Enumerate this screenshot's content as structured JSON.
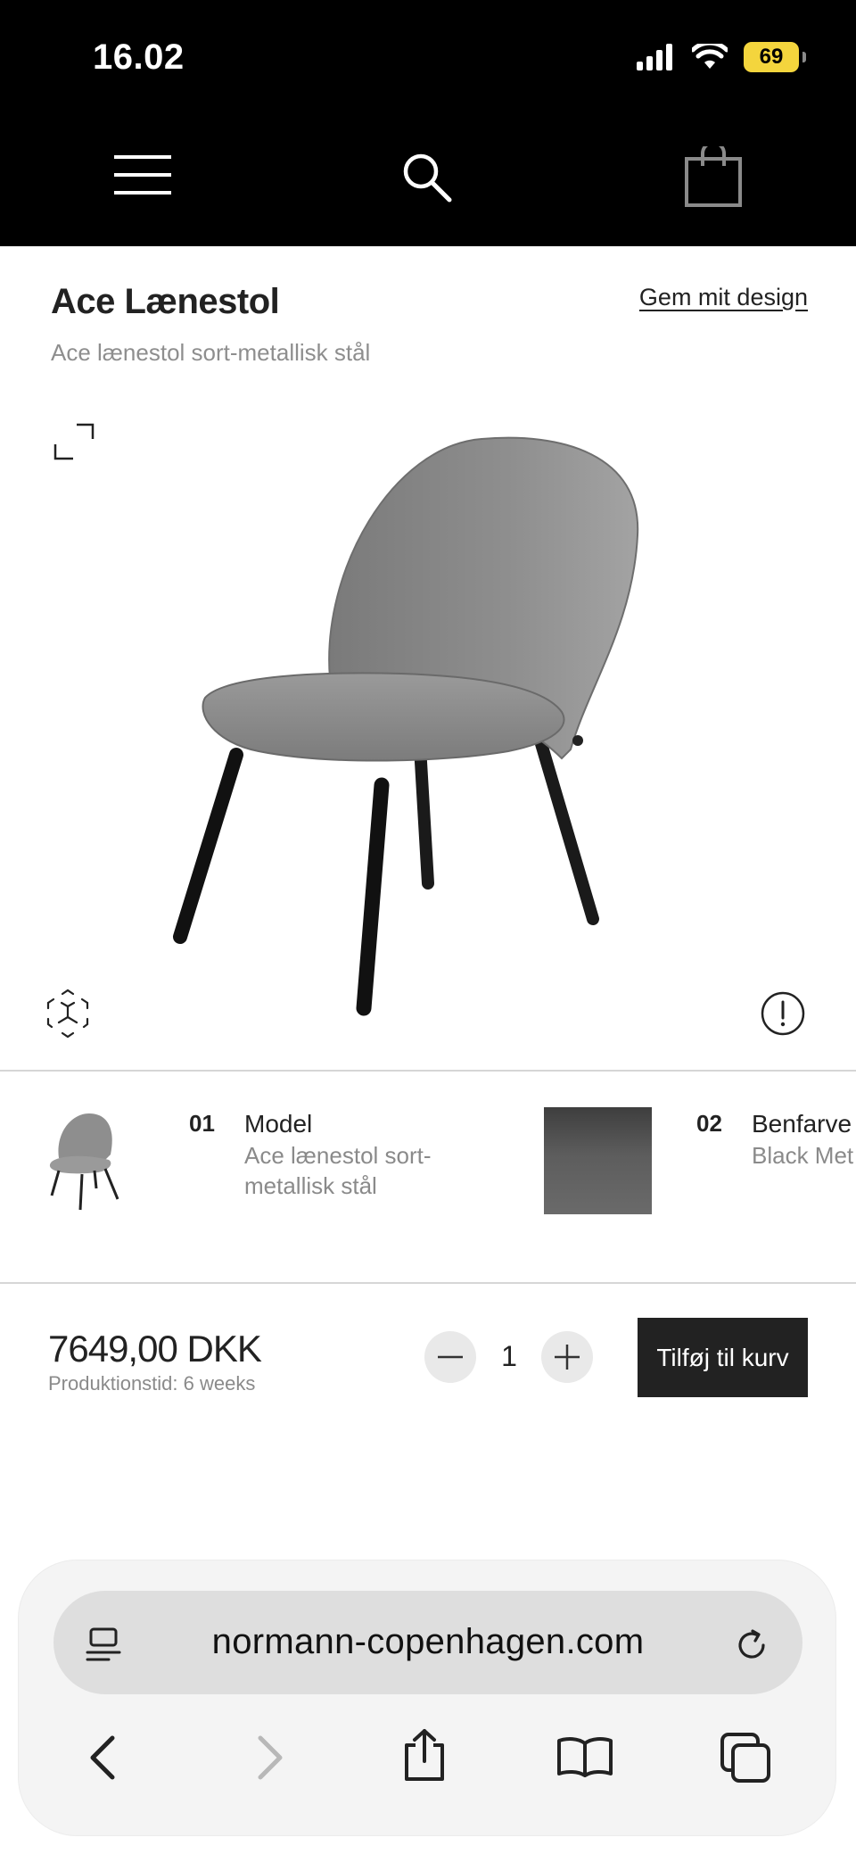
{
  "status_bar": {
    "time": "16.02",
    "battery": "69"
  },
  "header": {
    "menu_icon": "hamburger-menu-icon",
    "search_icon": "search-icon",
    "cart_icon": "shopping-bag-icon"
  },
  "product": {
    "title": "Ace Lænestol",
    "subtitle": "Ace lænestol sort-metallisk stål",
    "save_link": "Gem mit design"
  },
  "configurator": {
    "steps": [
      {
        "number": "01",
        "label": "Model",
        "value": "Ace lænestol sort-metallisk stål",
        "value_line1": "Ace lænestol sort-",
        "value_line2": "metallisk stål"
      },
      {
        "number": "02",
        "label": "Benfarve",
        "value": "Black Met",
        "swatch_color": "#4a4a4a"
      }
    ]
  },
  "purchase": {
    "price": "7649,00 DKK",
    "production_time": "Produktionstid: 6 weeks",
    "quantity": "1",
    "add_to_cart": "Tilføj til kurv"
  },
  "browser": {
    "url": "normann-copenhagen.com"
  },
  "colors": {
    "header_bg": "#000000",
    "text_primary": "#222222",
    "text_secondary": "#8e8e8e",
    "button_dark": "#222222",
    "battery": "#f4d53d"
  }
}
